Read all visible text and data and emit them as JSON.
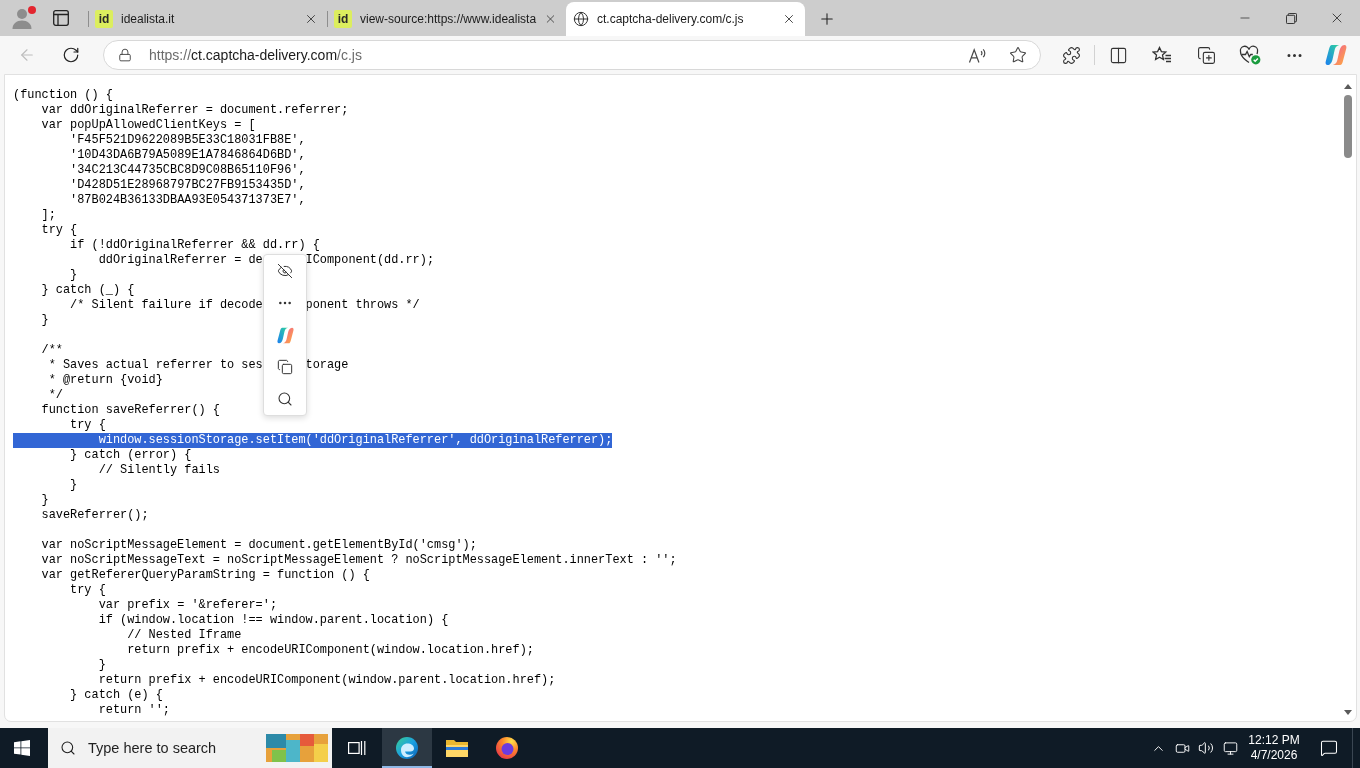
{
  "profile": {
    "notification": true
  },
  "tabs": [
    {
      "title": "idealista.it",
      "icon": {
        "kind": "badge",
        "text": "id"
      },
      "selected": false
    },
    {
      "title": "view-source:https://www.idealista",
      "icon": {
        "kind": "badge",
        "text": "id"
      },
      "selected": false
    },
    {
      "title": "ct.captcha-delivery.com/c.js",
      "icon": {
        "kind": "globe"
      },
      "selected": true
    }
  ],
  "toolbar": {
    "back": {
      "disabled": true
    },
    "address": {
      "scheme": "https://",
      "host": "ct.captcha-delivery.com",
      "path": "/c.js"
    }
  },
  "code": {
    "blocks": [
      {
        "lines": [
          {
            "text": "(function () {",
            "selected": false
          },
          {
            "text": "    var ddOriginalReferrer = document.referrer;",
            "selected": false
          },
          {
            "text": "    var popUpAllowedClientKeys = [",
            "selected": false
          },
          {
            "text": "        'F45F521D9622089B5E33C18031FB8E',",
            "selected": false
          },
          {
            "text": "        '10D43DA6B79A5089E1A7846864D6BD',",
            "selected": false
          },
          {
            "text": "        '34C213C44735CBC8D9C08B65110F96',",
            "selected": false
          },
          {
            "text": "        'D428D51E28968797BC27FB9153435D',",
            "selected": false
          },
          {
            "text": "        '87B024B36133DBAA93E054371373E7',",
            "selected": false
          },
          {
            "text": "    ];",
            "selected": false
          },
          {
            "text": "    try {",
            "selected": false
          },
          {
            "text": "        if (!ddOriginalReferrer && dd.rr) {",
            "selected": false
          },
          {
            "text": "            ddOriginalReferrer = de",
            "after_popup": "IComponent(dd.rr);",
            "selected": false
          },
          {
            "text": "        }",
            "selected": false
          },
          {
            "text": "    } catch (_) {",
            "selected": false
          },
          {
            "text": "        /* Silent failure if decode",
            "after_popup": "ponent throws */",
            "selected": false
          },
          {
            "text": "    }",
            "selected": false
          }
        ]
      },
      {
        "lines": [
          {
            "text": "    /**",
            "selected": false
          },
          {
            "text": "     * Saves actual referrer to ses",
            "after_popup": "torage",
            "selected": false
          },
          {
            "text": "     * @return {void}",
            "selected": false
          },
          {
            "text": "     */",
            "selected": false
          },
          {
            "text": "    function saveReferrer() {",
            "selected": false
          },
          {
            "text": "        try {",
            "selected": false
          },
          {
            "text": "            window.sessionStorage.setItem('ddOriginalReferrer', ddOriginalReferrer);",
            "selected": true
          },
          {
            "text": "        } catch (error) {",
            "selected": false
          },
          {
            "text": "            // Silently fails",
            "selected": false
          },
          {
            "text": "        }",
            "selected": false
          },
          {
            "text": "    }",
            "selected": false
          },
          {
            "text": "    saveReferrer();",
            "selected": false
          }
        ]
      },
      {
        "lines": [
          {
            "text": "    var noScriptMessageElement = document.getElementById('cmsg');",
            "selected": false
          },
          {
            "text": "    var noScriptMessageText = noScriptMessageElement ? noScriptMessageElement.innerText : '';",
            "selected": false
          },
          {
            "text": "    var getRefererQueryParamString = function () {",
            "selected": false
          },
          {
            "text": "        try {",
            "selected": false
          },
          {
            "text": "            var prefix = '&referer=';",
            "selected": false
          },
          {
            "text": "            if (window.location !== window.parent.location) {",
            "selected": false
          },
          {
            "text": "                // Nested Iframe",
            "selected": false
          },
          {
            "text": "                return prefix + encodeURIComponent(window.location.href);",
            "selected": false
          },
          {
            "text": "            }",
            "selected": false
          },
          {
            "text": "            return prefix + encodeURIComponent(window.parent.location.href);",
            "selected": false
          },
          {
            "text": "        } catch (e) {",
            "selected": false
          },
          {
            "text": "            return '';",
            "selected": false
          }
        ]
      }
    ]
  },
  "taskbar": {
    "search": {
      "placeholder": "Type here to search"
    },
    "apps": [
      {
        "kind": "browser",
        "active": true
      },
      {
        "kind": "folder",
        "active": false
      },
      {
        "kind": "fox",
        "active": false
      }
    ],
    "clock": {
      "time": "12:12 PM",
      "date": "4/7/2026"
    }
  }
}
